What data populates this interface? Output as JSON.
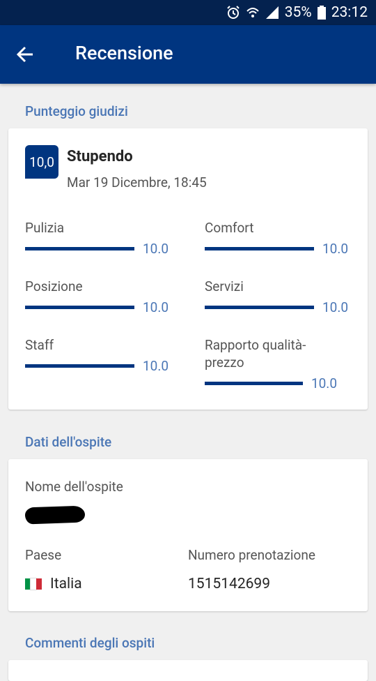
{
  "status_bar": {
    "battery": "35%",
    "time": "23:12",
    "icons": [
      "alarm-icon",
      "wifi-icon",
      "signal-icon",
      "battery-icon"
    ]
  },
  "app_bar": {
    "title": "Recensione",
    "back_icon": "arrow-back-icon"
  },
  "sections": {
    "scores_title": "Punteggio giudizi",
    "guest_title": "Dati dell'ospite",
    "comments_title": "Commenti degli ospiti"
  },
  "score": {
    "value": "10,0",
    "word": "Stupendo",
    "date": "Mar 19 Dicembre, 18:45"
  },
  "ratings": [
    {
      "label": "Pulizia",
      "value": "10.0",
      "fraction": 1.0
    },
    {
      "label": "Comfort",
      "value": "10.0",
      "fraction": 1.0
    },
    {
      "label": "Posizione",
      "value": "10.0",
      "fraction": 1.0
    },
    {
      "label": "Servizi",
      "value": "10.0",
      "fraction": 1.0
    },
    {
      "label": "Staff",
      "value": "10.0",
      "fraction": 1.0
    },
    {
      "label": "Rapporto qualità-prezzo",
      "value": "10.0",
      "fraction": 1.0
    }
  ],
  "guest": {
    "name_label": "Nome dell'ospite",
    "country_label": "Paese",
    "country": "Italia",
    "booking_label": "Numero prenotazione",
    "booking_number": "1515142699"
  },
  "colors": {
    "primary": "#003580",
    "status_bar": "#04224f",
    "accent_text": "#4a76b5",
    "background": "#f0f0f0"
  }
}
